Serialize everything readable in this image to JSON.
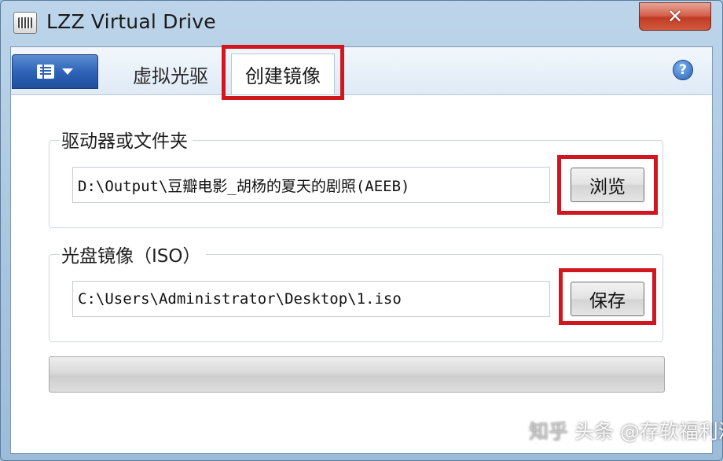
{
  "window": {
    "title": "LZZ Virtual Drive",
    "close_label": "✕"
  },
  "tabs": [
    {
      "label": "虚拟光驱",
      "selected": false
    },
    {
      "label": "创建镜像",
      "selected": true
    }
  ],
  "help": {
    "label": "?"
  },
  "source_group": {
    "label": "驱动器或文件夹",
    "path": "D:\\Output\\豆瓣电影_胡杨的夏天的剧照(AEEB)",
    "button_label": "浏览"
  },
  "iso_group": {
    "label": "光盘镜像（ISO）",
    "path": "C:\\Users\\Administrator\\Desktop\\1.iso",
    "button_label": "保存"
  },
  "progress": {
    "fraction": 0.0
  },
  "watermark": {
    "prefix": "知乎",
    "text": "头条 @存软福利汇"
  },
  "colors": {
    "highlight_border": "#d0161f",
    "menu_button": "#2f64b8"
  }
}
